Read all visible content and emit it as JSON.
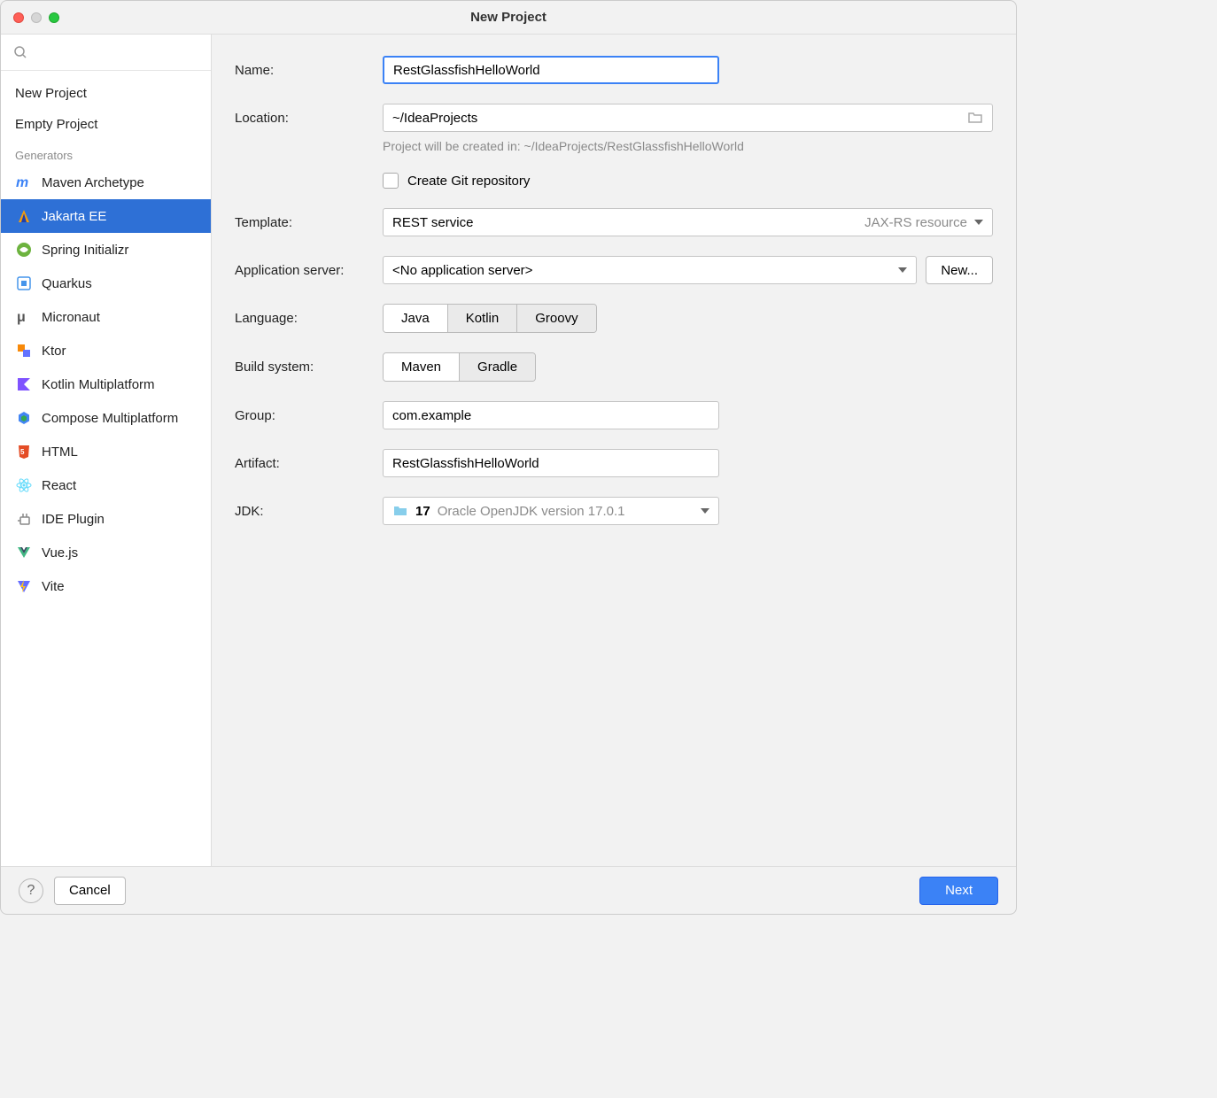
{
  "window": {
    "title": "New Project"
  },
  "sidebar": {
    "categories": [
      {
        "label": "New Project"
      },
      {
        "label": "Empty Project"
      }
    ],
    "generators_label": "Generators",
    "generators": [
      {
        "label": "Maven Archetype",
        "icon": "maven"
      },
      {
        "label": "Jakarta EE",
        "icon": "jakarta",
        "selected": true
      },
      {
        "label": "Spring Initializr",
        "icon": "spring"
      },
      {
        "label": "Quarkus",
        "icon": "quarkus"
      },
      {
        "label": "Micronaut",
        "icon": "micronaut"
      },
      {
        "label": "Ktor",
        "icon": "ktor"
      },
      {
        "label": "Kotlin Multiplatform",
        "icon": "kotlin"
      },
      {
        "label": "Compose Multiplatform",
        "icon": "compose"
      },
      {
        "label": "HTML",
        "icon": "html"
      },
      {
        "label": "React",
        "icon": "react"
      },
      {
        "label": "IDE Plugin",
        "icon": "plugin"
      },
      {
        "label": "Vue.js",
        "icon": "vue"
      },
      {
        "label": "Vite",
        "icon": "vite"
      }
    ]
  },
  "form": {
    "name_label": "Name:",
    "name_value": "RestGlassfishHelloWorld",
    "location_label": "Location:",
    "location_value": "~/IdeaProjects",
    "location_hint": "Project will be created in: ~/IdeaProjects/RestGlassfishHelloWorld",
    "git_label": "Create Git repository",
    "template_label": "Template:",
    "template_value": "REST service",
    "template_right": "JAX-RS resource",
    "appserver_label": "Application server:",
    "appserver_value": "<No application server>",
    "appserver_new_label": "New...",
    "language_label": "Language:",
    "languages": [
      "Java",
      "Kotlin",
      "Groovy"
    ],
    "language_selected": "Java",
    "build_label": "Build system:",
    "builds": [
      "Maven",
      "Gradle"
    ],
    "build_selected": "Maven",
    "group_label": "Group:",
    "group_value": "com.example",
    "artifact_label": "Artifact:",
    "artifact_value": "RestGlassfishHelloWorld",
    "jdk_label": "JDK:",
    "jdk_version": "17",
    "jdk_desc": "Oracle OpenJDK version 17.0.1"
  },
  "footer": {
    "cancel": "Cancel",
    "next": "Next"
  }
}
